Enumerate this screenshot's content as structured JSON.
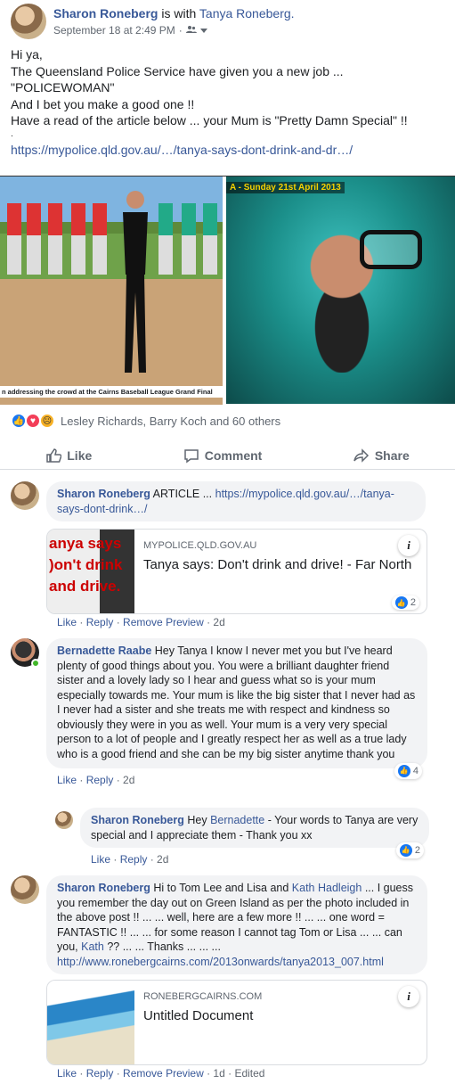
{
  "post": {
    "author": "Sharon Roneberg",
    "with_text": "is with",
    "tagged": "Tanya Roneberg.",
    "timestamp": "September 18 at 2:49 PM",
    "separator": "·",
    "audience_icon": "friends-icon",
    "lines": [
      "Hi ya,",
      "The Queensland Police Service have given you a new job ...",
      "\"POLICEWOMAN\"",
      "And I bet you make a good one !!",
      "Have a read of the article below ... your Mum is \"Pretty Damn Special\" !!",
      "."
    ],
    "link": "https://mypolice.qld.gov.au/…/tanya-says-dont-drink-and-dr…/",
    "photo_left_caption": "n addressing the crowd at the Cairns Baseball League Grand Final",
    "photo_right_banner": "A - Sunday 21st April 2013"
  },
  "reactions": {
    "text": "Lesley Richards, Barry Koch and 60 others"
  },
  "actions": {
    "like": "Like",
    "comment": "Comment",
    "share": "Share"
  },
  "comments": [
    {
      "author": "Sharon Roneberg",
      "text_plain": "ARTICLE ...",
      "link": "https://mypolice.qld.gov.au/…/tanya-says-dont-drink…/",
      "preview": {
        "thumb_text": "anya says\n)on't drink\nand drive.",
        "domain": "MYPOLICE.QLD.GOV.AU",
        "title": "Tanya says: Don't drink and drive! - Far North"
      },
      "like": "Like",
      "reply": "Reply",
      "remove": "Remove Preview",
      "age": "2d",
      "count": "2"
    },
    {
      "author": "Bernadette Raabe",
      "text": "Hey Tanya I know I never met you but I've heard plenty of good things about you. You were a brilliant daughter friend sister and a lovely lady so I hear and guess what so is your mum especially towards me. Your mum is like the big sister that I never had as I never had a sister and she treats me with respect and kindness so obviously they were in you as well. Your mum is a very very special person to a lot of people and I greatly respect her as well as a true lady who is a good friend and she can be my big sister anytime thank you",
      "like": "Like",
      "reply": "Reply",
      "age": "2d",
      "count": "4"
    },
    {
      "author": "Sharon Roneberg",
      "text_a": "Hey",
      "mention": "Bernadette",
      "text_b": "- Your words to Tanya are very special and I appreciate them - Thank you xx",
      "like": "Like",
      "reply": "Reply",
      "age": "2d",
      "count": "2"
    },
    {
      "author": "Sharon Roneberg",
      "text_a": "Hi to Tom Lee and Lisa and",
      "mention1": "Kath Hadleigh",
      "text_b": "... I guess you remember the day out on Green Island as per the photo included in the above post !! ... ... well, here are a few more !! ... ... one word = FANTASTIC !! ... ... for some reason I cannot tag Tom or Lisa ... ... can you,",
      "mention2": "Kath",
      "text_c": "?? ... ... Thanks ... ... ...",
      "link": "http://www.ronebergcairns.com/2013onwards/tanya2013_007.html",
      "preview": {
        "domain": "RONEBERGCAIRNS.COM",
        "title": "Untitled Document"
      },
      "like": "Like",
      "reply": "Reply",
      "remove": "Remove Preview",
      "age": "1d",
      "edited": "Edited"
    }
  ],
  "colors": {
    "link": "#385898",
    "like_blue": "#1877f2"
  }
}
